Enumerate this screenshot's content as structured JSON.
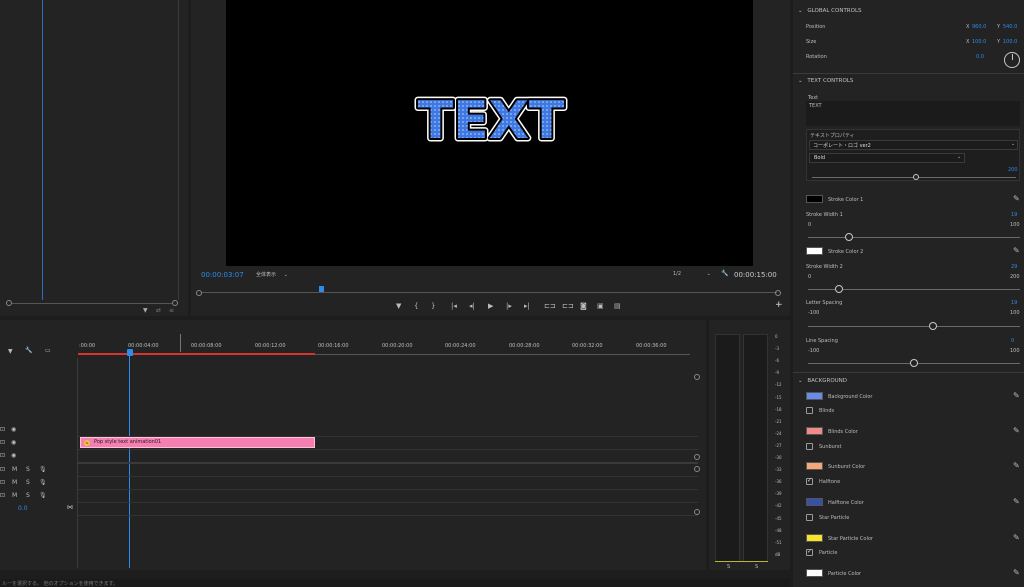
{
  "program_monitor": {
    "preview_text": "TEXT",
    "timecode_current": "00:00:03:07",
    "zoom": "全体表示",
    "resolution": "1/2",
    "timecode_duration": "00:00:15:00"
  },
  "timeline": {
    "ruler_labels": [
      ":00:00",
      "00:00:04:00",
      "00:00:08:00",
      "00:00:12:00",
      "00:00:16:00",
      "00:00:20:00",
      "00:00:24:00",
      "00:00:28:00",
      "00:00:32:00",
      "00:00:36:00"
    ],
    "clip_label": "Pop style text animation01",
    "clip_fx": "fx",
    "track_v_label": "V",
    "track_m_label": "M",
    "track_s_label": "S",
    "master_value": "0.0"
  },
  "meter": {
    "scale": [
      "0",
      "-3",
      "-6",
      "-9",
      "-12",
      "-15",
      "-18",
      "-21",
      "-24",
      "-27",
      "-30",
      "-33",
      "-36",
      "-39",
      "-42",
      "-45",
      "-48",
      "-51",
      "dB"
    ],
    "solo_left": "S",
    "solo_right": "S"
  },
  "essential_graphics": {
    "global_controls": {
      "header": "GLOBAL CONTROLS",
      "position_label": "Position",
      "position_x_label": "X",
      "position_x": "960.0",
      "position_y_label": "Y",
      "position_y": "540.0",
      "size_label": "Size",
      "size_x_label": "X",
      "size_x": "100.0",
      "size_y_label": "Y",
      "size_y": "100.0",
      "rotation_label": "Rotation",
      "rotation": "0.0"
    },
    "text_controls": {
      "header": "TEXT CONTROLS",
      "text_label": "Text",
      "text_value": "TEXT",
      "properties_label": "テキストプロパティ",
      "font": "コーポレート・ロゴ ver2",
      "font_style": "Bold",
      "font_size": "200",
      "stroke_color_1_label": "Stroke Color 1",
      "stroke_color_1": "#000000",
      "stroke_width_1_label": "Stroke Width 1",
      "stroke_width_1": "19",
      "stroke_width_1_min": "0",
      "stroke_width_1_max": "100",
      "stroke_color_2_label": "Stroke Color 2",
      "stroke_color_2": "#ffffff",
      "stroke_width_2_label": "Stroke Width 2",
      "stroke_width_2": "29",
      "stroke_width_2_min": "0",
      "stroke_width_2_max": "200",
      "letter_spacing_label": "Letter Spacing",
      "letter_spacing": "19",
      "letter_spacing_min": "-100",
      "letter_spacing_max": "100",
      "line_spacing_label": "Line Spacing",
      "line_spacing": "0",
      "line_spacing_min": "-100",
      "line_spacing_max": "100"
    },
    "background": {
      "header": "BACKGROUND",
      "background_color_label": "Background Color",
      "background_color": "#6b8bea",
      "blinds_label": "Blinds",
      "blinds_checked": false,
      "blinds_color_label": "Blinds Color",
      "blinds_color": "#f08c88",
      "sunburst_label": "Sunburst",
      "sunburst_checked": false,
      "sunburst_color_label": "Sunburst Color",
      "sunburst_color": "#f5a878",
      "halftone_label": "Halftone",
      "halftone_checked": true,
      "halftone_color_label": "Halftone Color",
      "halftone_color": "#3552a8",
      "star_particle_label": "Star Particle",
      "star_particle_checked": false,
      "star_particle_color_label": "Star Particle Color",
      "star_particle_color": "#f5e52a",
      "particle_label": "Particle",
      "particle_checked": true,
      "particle_color_label": "Particle Color",
      "particle_color": "#ffffff"
    }
  },
  "status_bar": "ルーを選択する。 他のオプションを使用できます。"
}
